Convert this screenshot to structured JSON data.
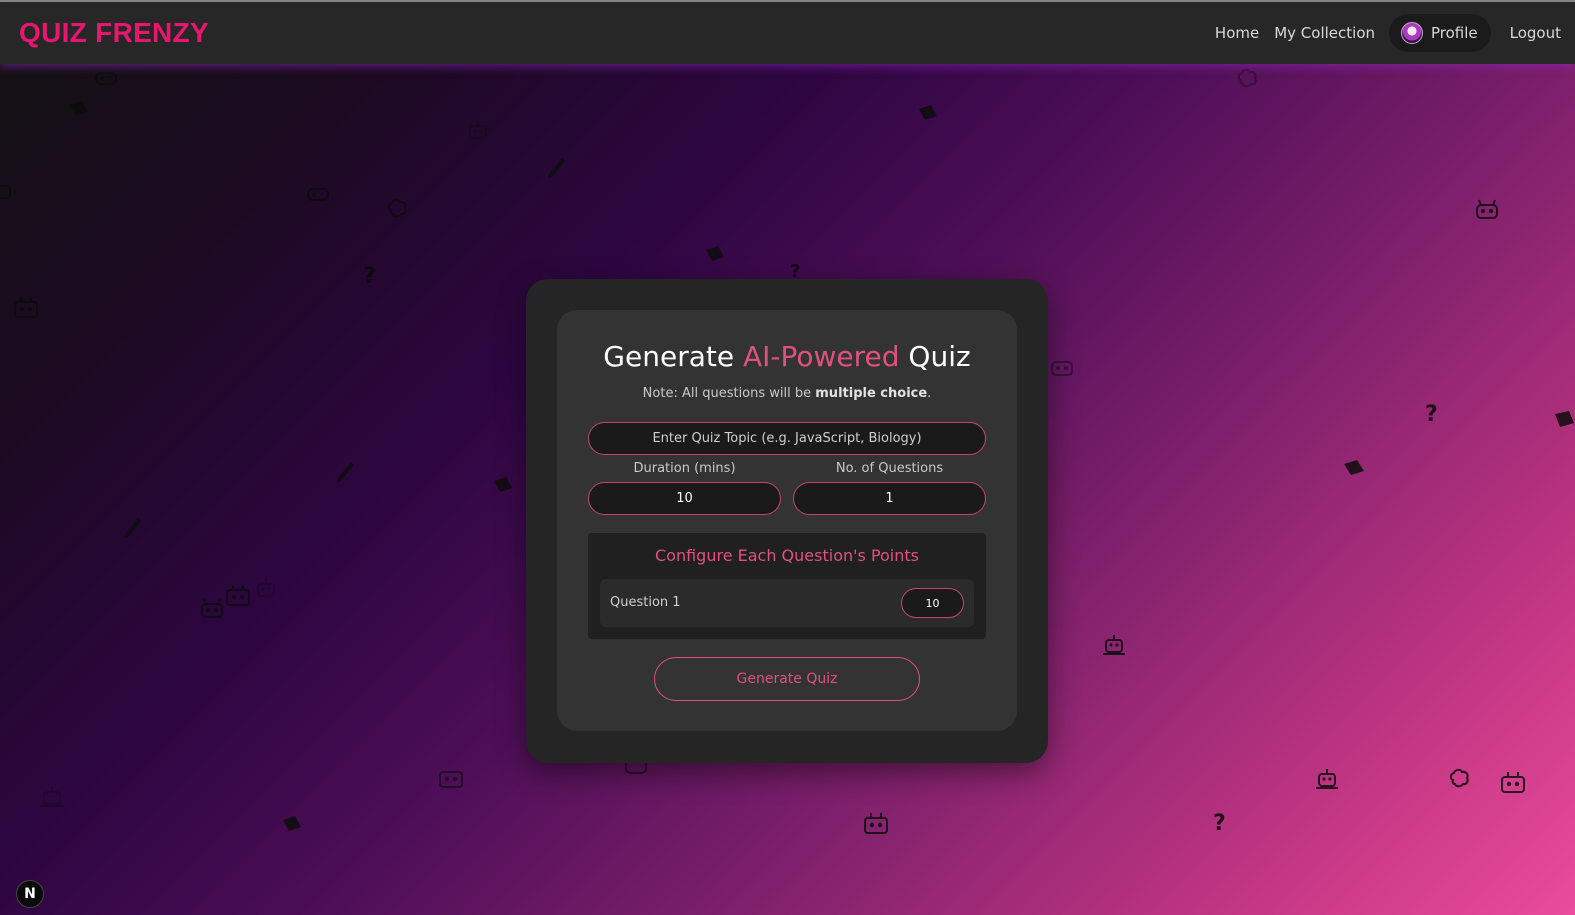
{
  "navbar": {
    "brand": "QUIZ FRENZY",
    "home_label": "Home",
    "collection_label": "My Collection",
    "profile_label": "Profile",
    "logout_label": "Logout"
  },
  "form": {
    "title_prefix": "Generate ",
    "title_accent": "AI-Powered",
    "title_suffix": " Quiz",
    "note_prefix": "Note: All questions will be ",
    "note_bold": "multiple choice",
    "note_suffix": ".",
    "topic_placeholder": "Enter Quiz Topic (e.g. JavaScript, Biology)",
    "duration_label": "Duration (mins)",
    "duration_value": "10",
    "questions_label": "No. of Questions",
    "questions_value": "1",
    "points_title": "Configure Each Question's Points",
    "questions": [
      {
        "label": "Question 1",
        "points": "10"
      }
    ],
    "generate_label": "Generate Quiz"
  },
  "badge": {
    "label": "N"
  },
  "colors": {
    "brand": "#e6176f",
    "accent": "#e0517e",
    "navbar_bg": "#272727",
    "card_outer": "#252525",
    "card_inner": "#333333"
  },
  "icons": [
    "gamepad-icon",
    "book-icon",
    "robot-icon",
    "pencil-icon",
    "brain-icon",
    "question-mark-icon",
    "next-logo-icon",
    "avatar-icon"
  ]
}
